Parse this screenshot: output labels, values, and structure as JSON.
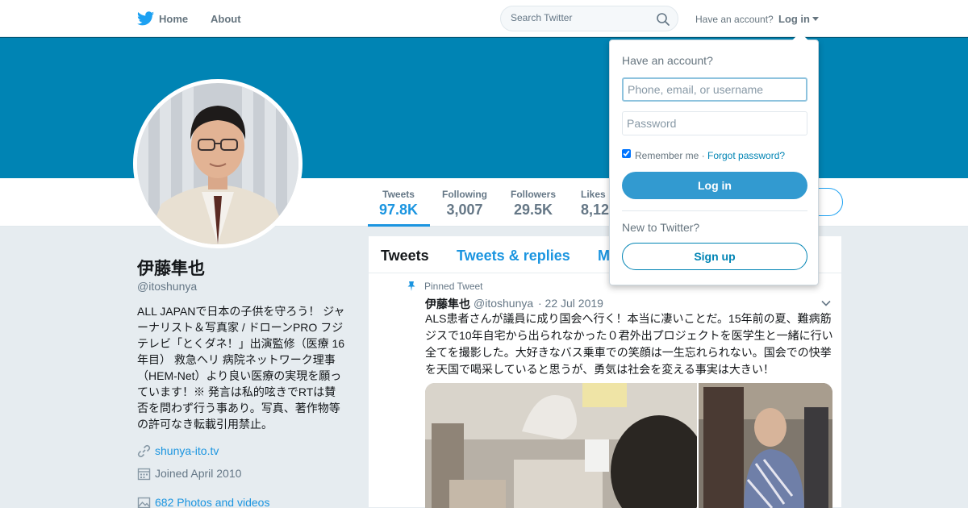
{
  "topnav": {
    "home_label": "Home",
    "about_label": "About",
    "search_placeholder": "Search Twitter",
    "have_account": "Have an account?",
    "login_label": "Log in"
  },
  "profile_nav": {
    "stats": [
      {
        "label": "Tweets",
        "value": "97.8K"
      },
      {
        "label": "Following",
        "value": "3,007"
      },
      {
        "label": "Followers",
        "value": "29.5K"
      },
      {
        "label": "Likes",
        "value": "8,12"
      }
    ]
  },
  "profile": {
    "name": "伊藤隼也",
    "handle": "@itoshunya",
    "bio": "ALL JAPANで日本の子供を守ろう！ ジャーナリスト＆写真家 / ドローンPRO フジテレビ「とくダネ！」出演監修（医療 16年目） 救急ヘリ 病院ネットワーク理事（HEM-Net）より良い医療の実現を願っています！※ 発言は私的呟きでRTは賛否を問わず行う事あり。写真、著作物等の許可なき転載引用禁止。",
    "website": "shunya-ito.tv",
    "joined": "Joined April 2010",
    "photos": "682 Photos and videos"
  },
  "timeline": {
    "tabs": [
      {
        "label": "Tweets"
      },
      {
        "label": "Tweets & replies"
      },
      {
        "label": "M"
      }
    ],
    "pinned_label": "Pinned Tweet",
    "tweet": {
      "name": "伊藤隼也",
      "handle": "@itoshunya",
      "date": "· 22 Jul 2019",
      "text": "ALS患者さんが議員に成り国会へ行く！本当に凄いことだ。15年前の夏、難病筋ジスで10年自宅から出られなかった０君外出プロジェクトを医学生と一緒に行い全てを撮影した。大好きなバス乗車での笑顔は一生忘れられない。国会での快挙を天国で喝采していると思うが、勇気は社会を変える事実は大きい！"
    }
  },
  "login_dropdown": {
    "title": "Have an account?",
    "username_placeholder": "Phone, email, or username",
    "password_placeholder": "Password",
    "remember_label": "Remember me ·",
    "forgot_label": "Forgot password?",
    "login_button": "Log in",
    "new_to": "New to Twitter?",
    "signup_button": "Sign up"
  },
  "colors": {
    "banner": "#0084b4",
    "accent": "#1b95e0",
    "login_button": "#329ad0"
  }
}
